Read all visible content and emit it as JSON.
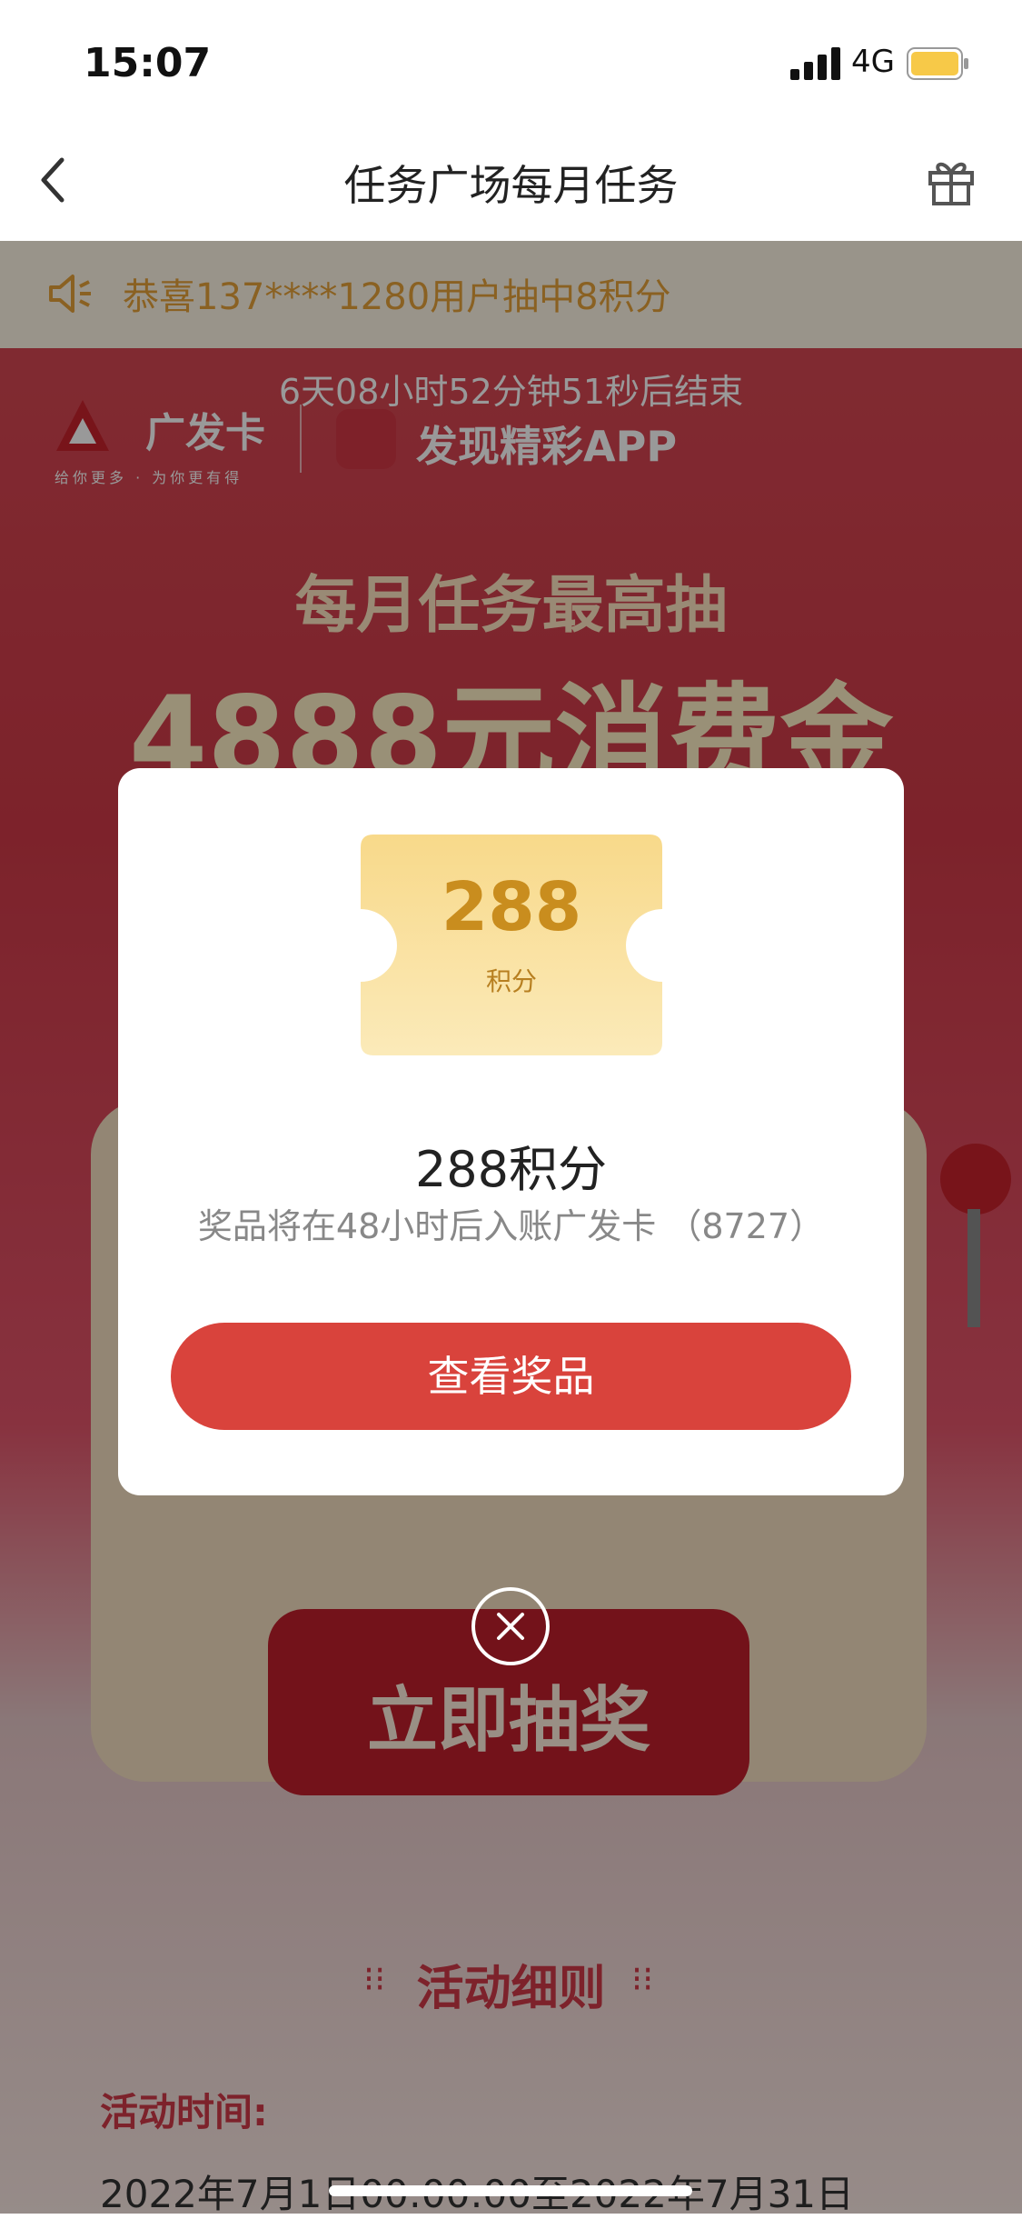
{
  "status_bar": {
    "time": "15:07",
    "network": "4G",
    "battery_color": "#f7c948"
  },
  "nav": {
    "title": "任务广场每月任务",
    "back_icon": "chevron-left-icon",
    "gift_icon": "gift-icon"
  },
  "ticker": {
    "text": "恭喜137****1280用户抽中8积分",
    "icon": "speaker-icon"
  },
  "countdown": "6天08小时52分钟51秒后结束",
  "brand": {
    "name": "广发卡",
    "tagline": "给你更多 · 为你更有得",
    "app_name": "发现精彩APP"
  },
  "headline": {
    "line1": "每月任务最高抽",
    "line2": "4888元消费金"
  },
  "machine": {
    "draw_label": "立即抽奖"
  },
  "rules": {
    "title": "活动细则",
    "dots": "⁝⁝",
    "activity_time_label": "活动时间:",
    "activity_time_value": "2022年7月1日00:00:00至2022年7月31日"
  },
  "modal": {
    "coupon_value": "288",
    "coupon_unit": "积分",
    "prize_title": "288积分",
    "prize_desc": "奖品将在48小时后入账广发卡 （8727）",
    "view_button": "查看奖品",
    "close_icon": "close-circle-icon"
  },
  "colors": {
    "accent_red": "#d9433c",
    "gold": "#c98d1e",
    "page_red": "#d03a48"
  }
}
